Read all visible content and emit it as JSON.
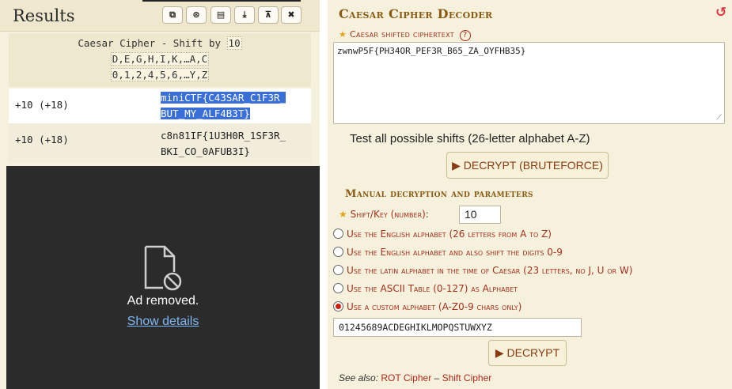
{
  "results": {
    "title": "Results",
    "toolbar": [
      {
        "icon": "copy-icon",
        "glyph": "⧉"
      },
      {
        "icon": "share-icon",
        "glyph": "⊛"
      },
      {
        "icon": "print-icon",
        "glyph": "▤"
      },
      {
        "icon": "download-icon",
        "glyph": "⤓"
      },
      {
        "icon": "pin-icon",
        "glyph": "⊼"
      },
      {
        "icon": "close-icon",
        "glyph": "✖"
      }
    ],
    "meta_line": "Caesar Cipher - Shift by",
    "meta_shift": "10",
    "meta_letters": "D,E,G,H,I,K,…A,C",
    "meta_digits": "0,1,2,4,5,6,…Y,Z",
    "rows": [
      {
        "shift": "+10 (+18)",
        "result_a": "miniCTF{C43SAR_C1F3R_",
        "result_b": "BUT_MY_ALF4B3T}"
      },
      {
        "shift": "+10 (+18)",
        "result_a": "c8n81IF{1U3H0R_1SF3R_",
        "result_b": "BKI_CO_0AFUB3I}"
      }
    ],
    "ad_text": "Ad removed.",
    "ad_link": "Show details"
  },
  "decoder": {
    "title": "Caesar Cipher Decoder",
    "ciphertext_label": "Caesar shifted ciphertext",
    "help": "?",
    "ciphertext": "zwnwP5F{PH34OR_PEF3R_B65_ZA_OYFHB35}",
    "test_all": "Test all possible shifts (26-letter alphabet A-Z)",
    "brute_button": "▶ DECRYPT (BRUTEFORCE)",
    "manual_title": "Manual decryption and parameters",
    "shift_label": "Shift/Key (number):",
    "shift_value": "10",
    "options": [
      "Use the English alphabet (26 letters from A to Z)",
      "Use the English alphabet and also shift the digits 0-9",
      "Use the latin alphabet in the time of Caesar (23 letters, no J, U or W)",
      "Use the ASCII Table (0-127) as Alphabet",
      "Use a custom alphabet (A-Z0-9 chars only)"
    ],
    "selected_option": 4,
    "custom_alphabet": "01245689ACDEGHIKLMOPQSTUWXYZ",
    "decrypt_button": "▶ DECRYPT",
    "see_also_prefix": "See also:",
    "see_also_link1": "ROT Cipher",
    "see_also_sep": "–",
    "see_also_link2": "Shift Cipher"
  },
  "colors": {
    "accent": "#8a5a12",
    "label": "#a4301c",
    "selection": "#3a6fd8"
  }
}
